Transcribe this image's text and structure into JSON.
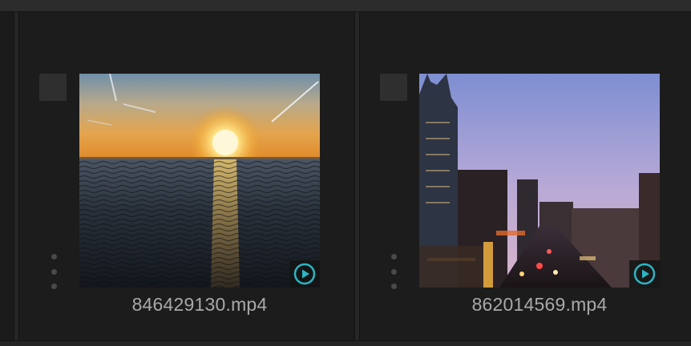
{
  "items": [
    {
      "filename": "846429130.mp4",
      "thumbnail_icon": "sunset-over-water-thumbnail",
      "badge_icon": "play-icon"
    },
    {
      "filename": "862014569.mp4",
      "thumbnail_icon": "city-street-dusk-thumbnail",
      "badge_icon": "play-icon"
    }
  ],
  "colors": {
    "accent": "#2bb6c4",
    "panel": "#1c1c1c",
    "text": "#a9a9a9"
  }
}
